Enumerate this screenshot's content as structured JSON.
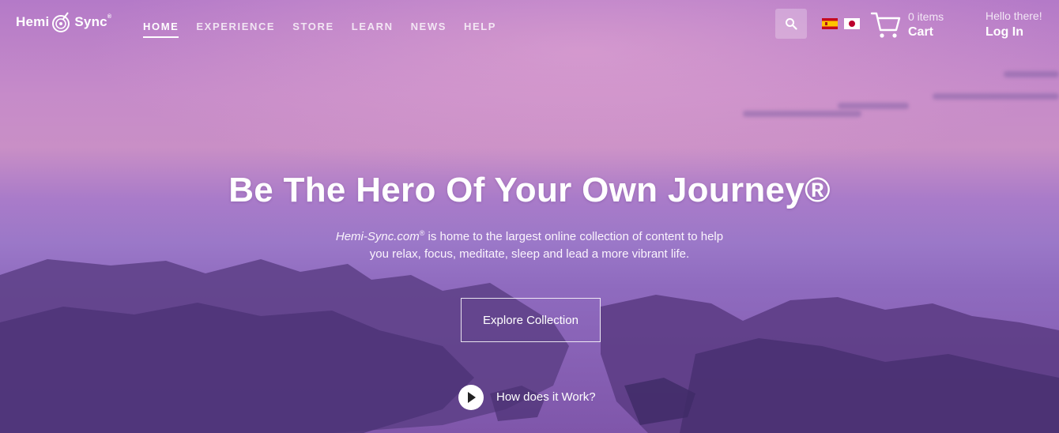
{
  "brand": {
    "logo_left": "Hemi",
    "logo_right": "Sync",
    "logo_mark": "®"
  },
  "nav": {
    "items": [
      {
        "label": "HOME",
        "active": true
      },
      {
        "label": "EXPERIENCE",
        "active": false
      },
      {
        "label": "STORE",
        "active": false
      },
      {
        "label": "LEARN",
        "active": false
      },
      {
        "label": "NEWS",
        "active": false
      },
      {
        "label": "HELP",
        "active": false
      }
    ]
  },
  "header": {
    "search_icon": "search-icon",
    "languages": [
      "Spanish flag",
      "Japanese flag"
    ],
    "cart": {
      "count": "0 items",
      "label": "Cart"
    },
    "account": {
      "greeting": "Hello there!",
      "login": "Log In"
    }
  },
  "hero": {
    "headline": "Be The Hero Of Your Own Journey®",
    "sub_brand": "Hemi-Sync.com",
    "sub_mark": "®",
    "sub_rest_line1": " is home to the largest online collection of content to help",
    "sub_line2": "you relax, focus, meditate, sleep and lead a more vibrant life.",
    "cta": "Explore Collection",
    "how": "How does it Work?"
  },
  "colors": {
    "accent": "#ffffff",
    "sky_top": "#b47ac8",
    "sky_mid": "#c98fc6",
    "sea": "#7f56aa"
  }
}
